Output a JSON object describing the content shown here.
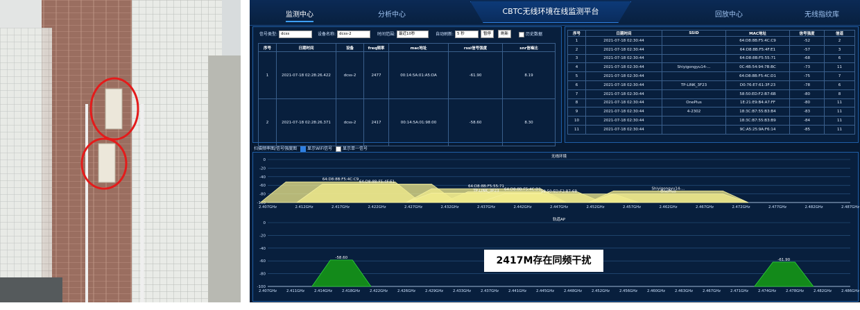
{
  "photo": {
    "description_icon": "antenna-photo"
  },
  "nav": {
    "monitor": "监测中心",
    "analysis": "分析中心",
    "title": "CBTC无线环境在线监测平台",
    "playback": "回放中心",
    "compare": "无线指纹库"
  },
  "controls": {
    "signal_type_label": "信号类型:",
    "signal_type_value": "dcss",
    "device_label": "设备名称:",
    "device_value": "dcss-2",
    "time_range_label": "时间范围:",
    "time_range_value": "最近10秒",
    "auto_refresh_label": "自动刷新:",
    "auto_refresh_value": "5 秒",
    "pause_button": "暂停",
    "refresh_button": "刷新",
    "history_label": "历史数据"
  },
  "left_table": {
    "headers": [
      "序号",
      "日期时间",
      "设备",
      "freq频率",
      "mac地址",
      "rssi信号强度",
      "snr信噪比"
    ],
    "rows": [
      [
        "1",
        "2021-07-18 02:28:26.422",
        "dcss-2",
        "2477",
        "00:14:5A:01:A5:DA",
        "-61.90",
        "8.19"
      ],
      [
        "2",
        "2021-07-18 02:28:26.371",
        "dcss-2",
        "2417",
        "00:14:5A:01:98:00",
        "-58.60",
        "8.30"
      ]
    ]
  },
  "right_table": {
    "headers": [
      "序号",
      "日期时间",
      "SSID",
      "MAC地址",
      "信号强度",
      "信道"
    ],
    "rows": [
      [
        "1",
        "2021-07-18 02:30:44",
        "",
        "64:D8:8B:F5:4C:C9",
        "-52",
        "2"
      ],
      [
        "2",
        "2021-07-18 02:30:44",
        "",
        "64:D8:8B:F5:4F:E1",
        "-57",
        "3"
      ],
      [
        "3",
        "2021-07-18 02:30:44",
        "",
        "64:D8:8B:F5:55:71",
        "-68",
        "6"
      ],
      [
        "4",
        "2021-07-18 02:30:44",
        "Shiyigongyu14-...",
        "0C:4B:54:94:7B:BC",
        "-73",
        "11"
      ],
      [
        "5",
        "2021-07-18 02:30:44",
        "",
        "64:D8:8B:F5:4C:D1",
        "-75",
        "7"
      ],
      [
        "6",
        "2021-07-18 02:30:44",
        "TP-LINK_3F23",
        "D0:76:E7:61:3F:23",
        "-78",
        "6"
      ],
      [
        "7",
        "2021-07-18 02:30:44",
        "",
        "58:50:ED:F2:B7:6B",
        "-80",
        "8"
      ],
      [
        "8",
        "2021-07-18 02:30:44",
        "OnePlus",
        "1E:21:E9:B4:A7:FF",
        "-80",
        "11"
      ],
      [
        "9",
        "2021-07-18 02:30:44",
        "4-2302",
        "18:3C:B7:55:B3:B4",
        "-83",
        "11"
      ],
      [
        "10",
        "2021-07-18 02:30:44",
        "",
        "18:3C:B7:55:B3:B9",
        "-84",
        "11"
      ],
      [
        "11",
        "2021-07-18 02:30:44",
        "",
        "9C:A5:25:9A:F6:14",
        "-85",
        "11"
      ]
    ]
  },
  "chart_options": {
    "label": "扫描频率图/信号强度图",
    "opt1": "显示WiFi信号",
    "opt2": "显示单一信号"
  },
  "chart_data": [
    {
      "type": "area",
      "title": "无线环境",
      "ylim": [
        -100,
        0
      ],
      "yticks": [
        "0",
        "-20",
        "-40",
        "-60",
        "-80",
        "-100"
      ],
      "xticks": [
        "2.407GHz",
        "2.412GHz",
        "2.417GHz",
        "2.422GHz",
        "2.427GHz",
        "2.432GHz",
        "2.437GHz",
        "2.442GHz",
        "2.447GHz",
        "2.452GHz",
        "2.457GHz",
        "2.462GHz",
        "2.467GHz",
        "2.472GHz",
        "2.477GHz",
        "2.482GHz",
        "2.487GHz"
      ],
      "xrange": [
        2.407,
        2.487
      ],
      "series": [
        {
          "name": "64:D8:8B:F5:4C:C9",
          "center": 2.417,
          "value": -52
        },
        {
          "name": "64:D8:8B:F5:4F:E1",
          "center": 2.422,
          "value": -57
        },
        {
          "name": "64:D8:8B:F5:55:71",
          "center": 2.437,
          "value": -68
        },
        {
          "name": "Shiyigongyu14-...",
          "center": 2.462,
          "value": -73
        },
        {
          "name": "64:D8:8B:F5:4C:D1",
          "center": 2.442,
          "value": -75
        },
        {
          "name": "TP-LINK_3F23",
          "center": 2.437,
          "value": -78
        },
        {
          "name": "58:50:ED:F2:B7:6B",
          "center": 2.447,
          "value": -80
        },
        {
          "name": "OnePlus",
          "center": 2.462,
          "value": -80
        }
      ]
    },
    {
      "type": "area",
      "title": "轨道AP",
      "ylim": [
        -100,
        0
      ],
      "yticks": [
        "0",
        "-20",
        "-40",
        "-60",
        "-80",
        "-100"
      ],
      "xticks": [
        "2.407GHz",
        "2.411GHz",
        "2.414GHz",
        "2.418GHz",
        "2.422GHz",
        "2.426GHz",
        "2.429GHz",
        "2.433GHz",
        "2.437GHz",
        "2.441GHz",
        "2.445GHz",
        "2.448GHz",
        "2.452GHz",
        "2.456GHz",
        "2.460GHz",
        "2.463GHz",
        "2.467GHz",
        "2.471GHz",
        "2.474GHz",
        "2.478GHz",
        "2.482GHz",
        "2.486GHz"
      ],
      "xrange": [
        2.407,
        2.486
      ],
      "series": [
        {
          "name": "-58.60",
          "center": 2.417,
          "value": -58.6
        },
        {
          "name": "-61.90",
          "center": 2.477,
          "value": -61.9
        }
      ]
    }
  ],
  "annotation": "2417M存在同频干扰"
}
